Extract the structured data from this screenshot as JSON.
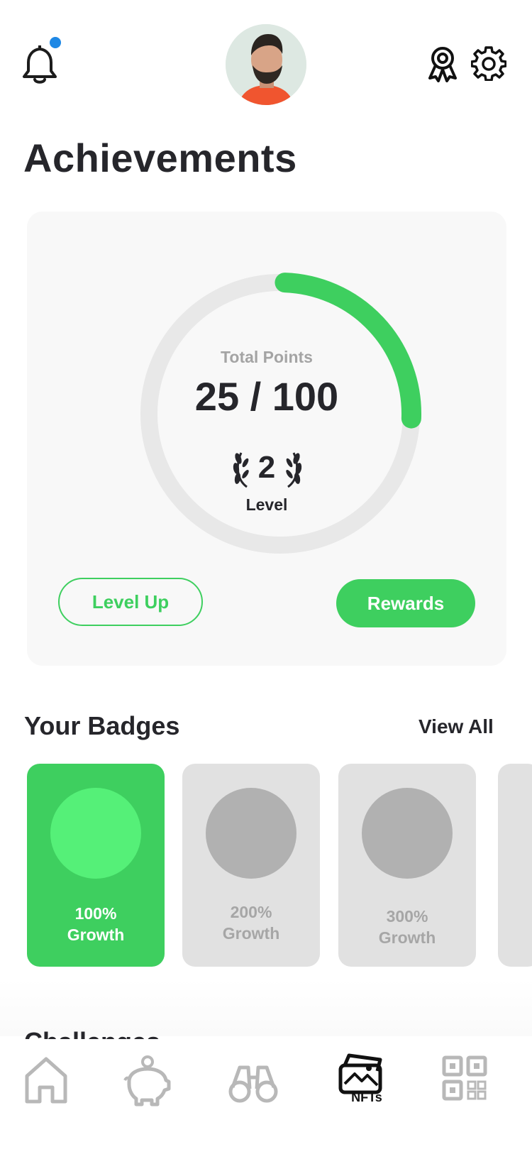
{
  "header": {
    "notification_dot_color": "#1e88e5",
    "icons": [
      "bell-icon",
      "avatar",
      "award-ribbon-icon",
      "gear-icon"
    ]
  },
  "page": {
    "title": "Achievements"
  },
  "points_card": {
    "total_label": "Total Points",
    "total_value": "25 / 100",
    "progress": 0.25,
    "level_number": "2",
    "level_label": "Level",
    "level_up_label": "Level Up",
    "rewards_label": "Rewards",
    "accent_color": "#3ecf5f"
  },
  "badges_section": {
    "title": "Your Badges",
    "view_all_label": "View All",
    "items": [
      {
        "line1": "100%",
        "line2": "Growth",
        "active": true
      },
      {
        "line1": "200%",
        "line2": "Growth",
        "active": false
      },
      {
        "line1": "300%",
        "line2": "Growth",
        "active": false
      }
    ]
  },
  "next_section": {
    "title_partial": "Challenges"
  },
  "tabbar": {
    "items": [
      {
        "icon": "home-icon",
        "label": ""
      },
      {
        "icon": "piggy-bank-icon",
        "label": ""
      },
      {
        "icon": "binoculars-icon",
        "label": ""
      },
      {
        "icon": "nft-image-icon",
        "label": "NFTs",
        "active": true
      },
      {
        "icon": "qr-code-icon",
        "label": ""
      }
    ]
  }
}
